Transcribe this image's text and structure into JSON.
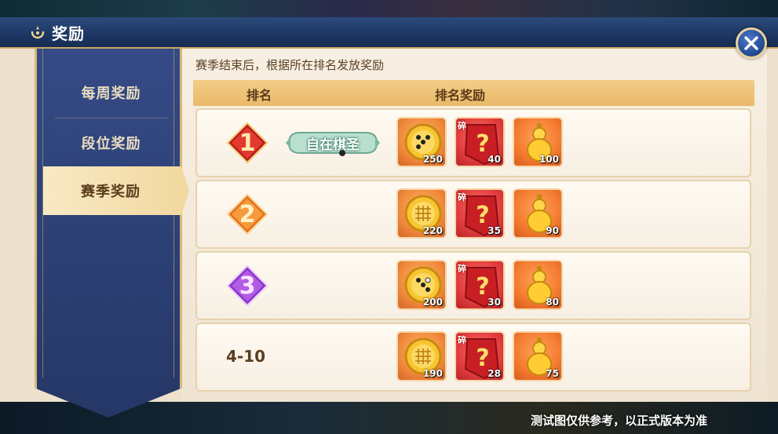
{
  "header": {
    "title": "奖励"
  },
  "sidebar": {
    "items": [
      {
        "label": "每周奖励",
        "active": false
      },
      {
        "label": "段位奖励",
        "active": false
      },
      {
        "label": "赛季奖励",
        "active": true
      }
    ]
  },
  "content": {
    "subtitle": "赛季结束后，根据所在排名发放奖励",
    "table": {
      "columns": [
        "排名",
        "排名奖励"
      ],
      "rows": [
        {
          "rank": "1",
          "title_badge": "自在棋圣",
          "rewards": [
            {
              "type": "coin",
              "qty": "250"
            },
            {
              "type": "fragment",
              "tag": "碎",
              "qty": "40"
            },
            {
              "type": "gold",
              "qty": "100"
            }
          ]
        },
        {
          "rank": "2",
          "rewards": [
            {
              "type": "coin",
              "qty": "220"
            },
            {
              "type": "fragment",
              "tag": "碎",
              "qty": "35"
            },
            {
              "type": "gold",
              "qty": "90"
            }
          ]
        },
        {
          "rank": "3",
          "rewards": [
            {
              "type": "coin",
              "qty": "200"
            },
            {
              "type": "fragment",
              "tag": "碎",
              "qty": "30"
            },
            {
              "type": "gold",
              "qty": "80"
            }
          ]
        },
        {
          "rank": "4-10",
          "rewards": [
            {
              "type": "coin",
              "qty": "190"
            },
            {
              "type": "fragment",
              "tag": "碎",
              "qty": "28"
            },
            {
              "type": "gold",
              "qty": "75"
            }
          ]
        }
      ]
    }
  },
  "footer": {
    "note": "测试图仅供参考，以正式版本为准"
  },
  "colors": {
    "rank1": "#d42a2a",
    "rank2": "#f08a2a",
    "rank3": "#9a3fd0",
    "accent_gold": "#e9b96a",
    "panel_blue": "#2c3f73"
  }
}
